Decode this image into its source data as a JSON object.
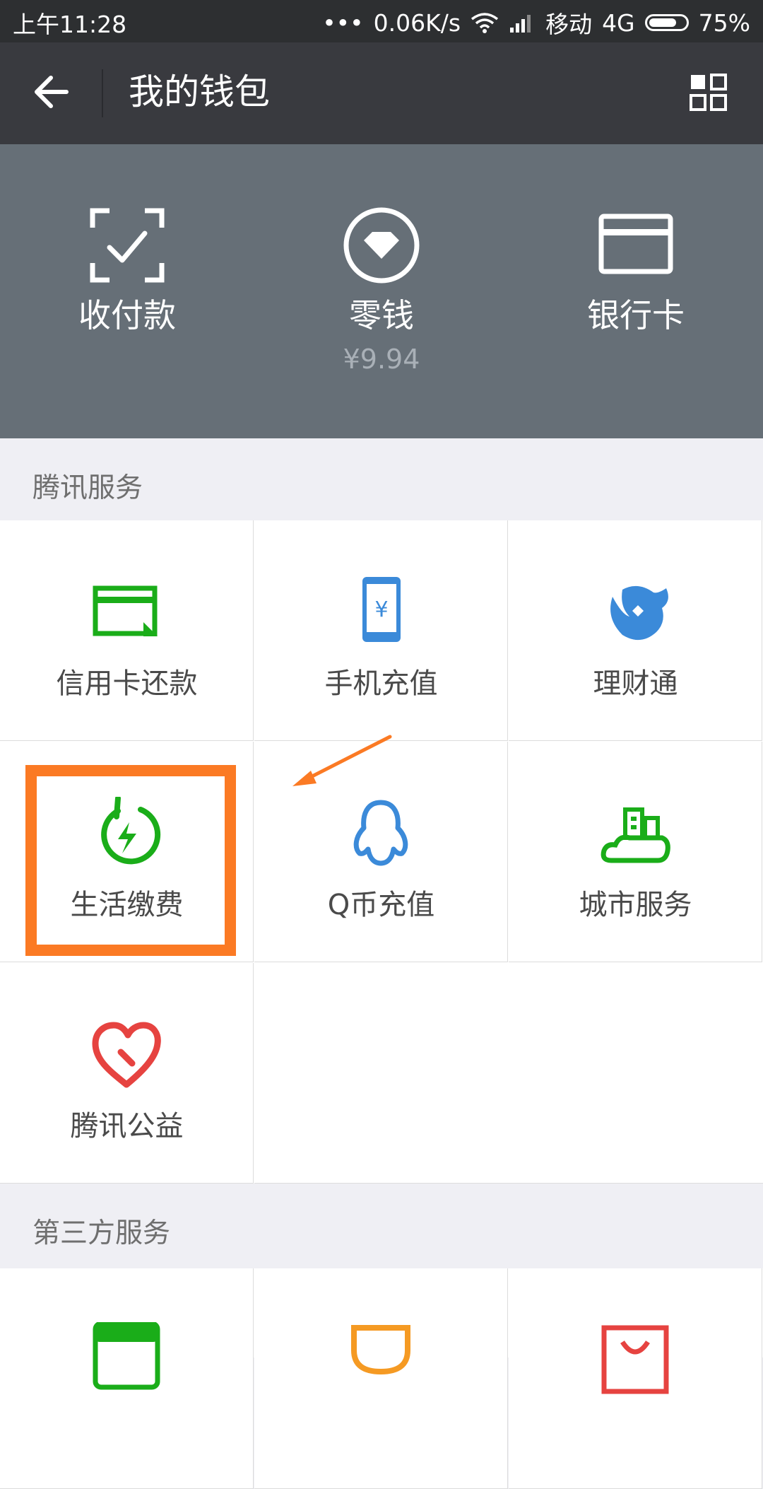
{
  "status_bar": {
    "time": "上午11:28",
    "signal_dots": "•••",
    "speed": "0.06K/s",
    "carrier": "移动",
    "network": "4G",
    "battery": "75%",
    "battery_level": 0.75
  },
  "app_bar": {
    "title": "我的钱包"
  },
  "hero": {
    "items": [
      {
        "label": "收付款",
        "icon": "scan-check-icon"
      },
      {
        "label": "零钱",
        "amount": "¥9.94",
        "icon": "diamond-circle-icon"
      },
      {
        "label": "银行卡",
        "icon": "card-icon"
      }
    ]
  },
  "tencent_services": {
    "title": "腾讯服务",
    "items": [
      {
        "label": "信用卡还款",
        "icon": "credit-card-icon",
        "color": "#1aad19"
      },
      {
        "label": "手机充值",
        "icon": "phone-yuan-icon",
        "color": "#3b8ad9"
      },
      {
        "label": "理财通",
        "icon": "fish-icon",
        "color": "#3b8ad9"
      },
      {
        "label": "生活缴费",
        "icon": "lightning-ring-icon",
        "color": "#1aad19"
      },
      {
        "label": "Q币充值",
        "icon": "penguin-icon",
        "color": "#3b8ad9"
      },
      {
        "label": "城市服务",
        "icon": "city-cloud-icon",
        "color": "#1aad19"
      },
      {
        "label": "腾讯公益",
        "icon": "heart-icon",
        "color": "#e64340"
      }
    ]
  },
  "third_party": {
    "title": "第三方服务",
    "items": [
      {
        "icon": "train-ticket-icon",
        "color": "#1aad19"
      },
      {
        "icon": "cup-icon",
        "color": "#f59a23"
      },
      {
        "icon": "shopping-bag-icon",
        "color": "#e64340"
      }
    ]
  },
  "annotation": {
    "highlight_color": "#fb7a24"
  }
}
